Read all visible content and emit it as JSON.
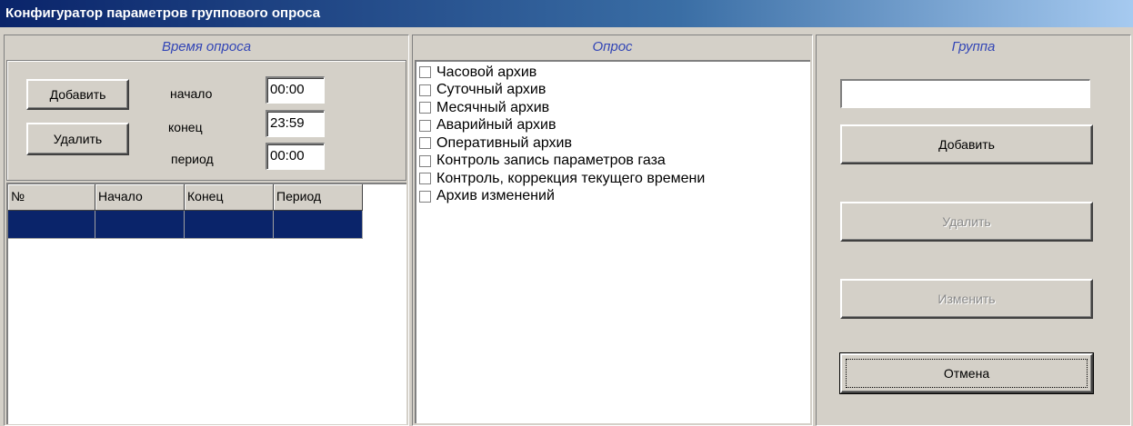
{
  "window": {
    "title": "Конфигуратор параметров группового опроса"
  },
  "time_panel": {
    "header": "Время опроса",
    "add_label": "Добавить",
    "delete_label": "Удалить",
    "start_label": "начало",
    "end_label": "конец",
    "period_label": "период",
    "start_value": "00:00",
    "end_value": "23:59",
    "period_value": "00:00",
    "table": {
      "columns": [
        "№",
        "Начало",
        "Конец",
        "Период"
      ],
      "rows": [
        [
          "",
          "",
          "",
          ""
        ]
      ]
    }
  },
  "poll_panel": {
    "header": "Опрос",
    "items": [
      {
        "label": "Часовой архив",
        "checked": false
      },
      {
        "label": "Суточный архив",
        "checked": false
      },
      {
        "label": "Месячный архив",
        "checked": false
      },
      {
        "label": "Аварийный архив",
        "checked": false
      },
      {
        "label": "Оперативный архив",
        "checked": false
      },
      {
        "label": "Контроль запись параметров газа",
        "checked": false
      },
      {
        "label": "Контроль, коррекция текущего времени",
        "checked": false
      },
      {
        "label": "Архив изменений",
        "checked": false
      }
    ]
  },
  "group_panel": {
    "header": "Группа",
    "name_value": "",
    "add_label": "Добавить",
    "delete_label": "Удалить",
    "edit_label": "Изменить",
    "cancel_label": "Отмена"
  },
  "colors": {
    "title_bar": "#0a246a",
    "header_text": "#3346b6",
    "selection": "#0a246a",
    "face": "#d4d0c8"
  }
}
